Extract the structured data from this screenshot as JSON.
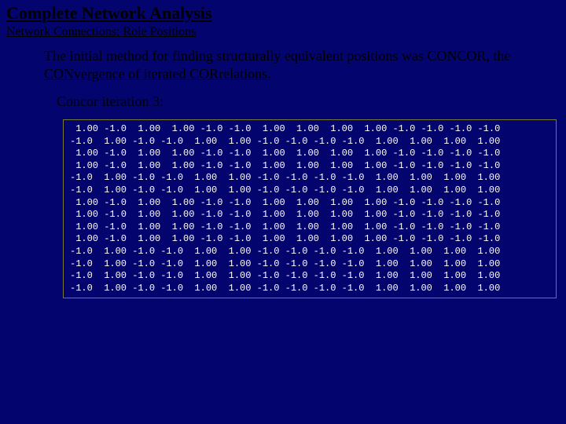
{
  "title": "Complete Network Analysis",
  "subtitle": "Network Connections: Role Positions",
  "body_prefix": "The initial method for finding structurally equivalent positions was CONCOR, the ",
  "body_underlined": "CONvergence of iterated CORrelations.",
  "iteration_label": "Concor iteration 3:",
  "matrix": [
    [
      " 1.00",
      "-1.0",
      " 1.00",
      " 1.00",
      "-1.0",
      "-1.0",
      " 1.00",
      " 1.00",
      " 1.00",
      " 1.00",
      "-1.0",
      "-1.0",
      "-1.0",
      "-1.0"
    ],
    [
      "-1.0",
      " 1.00",
      "-1.0",
      "-1.0",
      " 1.00",
      " 1.00",
      "-1.0",
      "-1.0",
      "-1.0",
      "-1.0",
      " 1.00",
      " 1.00",
      " 1.00",
      " 1.00"
    ],
    [
      " 1.00",
      "-1.0",
      " 1.00",
      " 1.00",
      "-1.0",
      "-1.0",
      " 1.00",
      " 1.00",
      " 1.00",
      " 1.00",
      "-1.0",
      "-1.0",
      "-1.0",
      "-1.0"
    ],
    [
      " 1.00",
      "-1.0",
      " 1.00",
      " 1.00",
      "-1.0",
      "-1.0",
      " 1.00",
      " 1.00",
      " 1.00",
      " 1.00",
      "-1.0",
      "-1.0",
      "-1.0",
      "-1.0"
    ],
    [
      "-1.0",
      " 1.00",
      "-1.0",
      "-1.0",
      " 1.00",
      " 1.00",
      "-1.0",
      "-1.0",
      "-1.0",
      "-1.0",
      " 1.00",
      " 1.00",
      " 1.00",
      " 1.00"
    ],
    [
      "-1.0",
      " 1.00",
      "-1.0",
      "-1.0",
      " 1.00",
      " 1.00",
      "-1.0",
      "-1.0",
      "-1.0",
      "-1.0",
      " 1.00",
      " 1.00",
      " 1.00",
      " 1.00"
    ],
    [
      " 1.00",
      "-1.0",
      " 1.00",
      " 1.00",
      "-1.0",
      "-1.0",
      " 1.00",
      " 1.00",
      " 1.00",
      " 1.00",
      "-1.0",
      "-1.0",
      "-1.0",
      "-1.0"
    ],
    [
      " 1.00",
      "-1.0",
      " 1.00",
      " 1.00",
      "-1.0",
      "-1.0",
      " 1.00",
      " 1.00",
      " 1.00",
      " 1.00",
      "-1.0",
      "-1.0",
      "-1.0",
      "-1.0"
    ],
    [
      " 1.00",
      "-1.0",
      " 1.00",
      " 1.00",
      "-1.0",
      "-1.0",
      " 1.00",
      " 1.00",
      " 1.00",
      " 1.00",
      "-1.0",
      "-1.0",
      "-1.0",
      "-1.0"
    ],
    [
      " 1.00",
      "-1.0",
      " 1.00",
      " 1.00",
      "-1.0",
      "-1.0",
      " 1.00",
      " 1.00",
      " 1.00",
      " 1.00",
      "-1.0",
      "-1.0",
      "-1.0",
      "-1.0"
    ],
    [
      "-1.0",
      " 1.00",
      "-1.0",
      "-1.0",
      " 1.00",
      " 1.00",
      "-1.0",
      "-1.0",
      "-1.0",
      "-1.0",
      " 1.00",
      " 1.00",
      " 1.00",
      " 1.00"
    ],
    [
      "-1.0",
      " 1.00",
      "-1.0",
      "-1.0",
      " 1.00",
      " 1.00",
      "-1.0",
      "-1.0",
      "-1.0",
      "-1.0",
      " 1.00",
      " 1.00",
      " 1.00",
      " 1.00"
    ],
    [
      "-1.0",
      " 1.00",
      "-1.0",
      "-1.0",
      " 1.00",
      " 1.00",
      "-1.0",
      "-1.0",
      "-1.0",
      "-1.0",
      " 1.00",
      " 1.00",
      " 1.00",
      " 1.00"
    ],
    [
      "-1.0",
      " 1.00",
      "-1.0",
      "-1.0",
      " 1.00",
      " 1.00",
      "-1.0",
      "-1.0",
      "-1.0",
      "-1.0",
      " 1.00",
      " 1.00",
      " 1.00",
      " 1.00"
    ]
  ]
}
